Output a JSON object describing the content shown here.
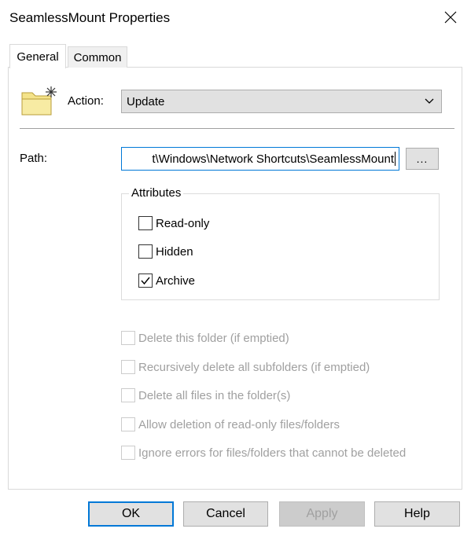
{
  "window": {
    "title": "SeamlessMount Properties"
  },
  "tabs": [
    {
      "label": "General",
      "active": true
    },
    {
      "label": "Common",
      "active": false
    }
  ],
  "icons": {
    "folder": "folder-new-icon",
    "close": "close-icon",
    "dropdown": "chevron-down-icon",
    "check": "checkmark-icon"
  },
  "action": {
    "label": "Action:",
    "selected": "Update"
  },
  "path": {
    "label": "Path:",
    "value": "t\\Windows\\Network Shortcuts\\SeamlessMount",
    "browse_label": "..."
  },
  "attributes": {
    "legend": "Attributes",
    "items": [
      {
        "label": "Read-only",
        "checked": false
      },
      {
        "label": "Hidden",
        "checked": false
      },
      {
        "label": "Archive",
        "checked": true
      }
    ]
  },
  "delete_options": [
    {
      "label": "Delete this folder (if emptied)",
      "checked": false,
      "enabled": false
    },
    {
      "label": "Recursively delete all subfolders (if emptied)",
      "checked": false,
      "enabled": false
    },
    {
      "label": "Delete all files in the folder(s)",
      "checked": false,
      "enabled": false
    },
    {
      "label": "Allow deletion of read-only files/folders",
      "checked": false,
      "enabled": false
    },
    {
      "label": "Ignore errors for files/folders that cannot be deleted",
      "checked": false,
      "enabled": false
    }
  ],
  "buttons": {
    "ok": "OK",
    "cancel": "Cancel",
    "apply": "Apply",
    "help": "Help"
  },
  "colors": {
    "accent": "#0078d7",
    "button_face": "#e1e1e1",
    "disabled_text": "#a0a0a0",
    "folder": "#f4e38a"
  }
}
